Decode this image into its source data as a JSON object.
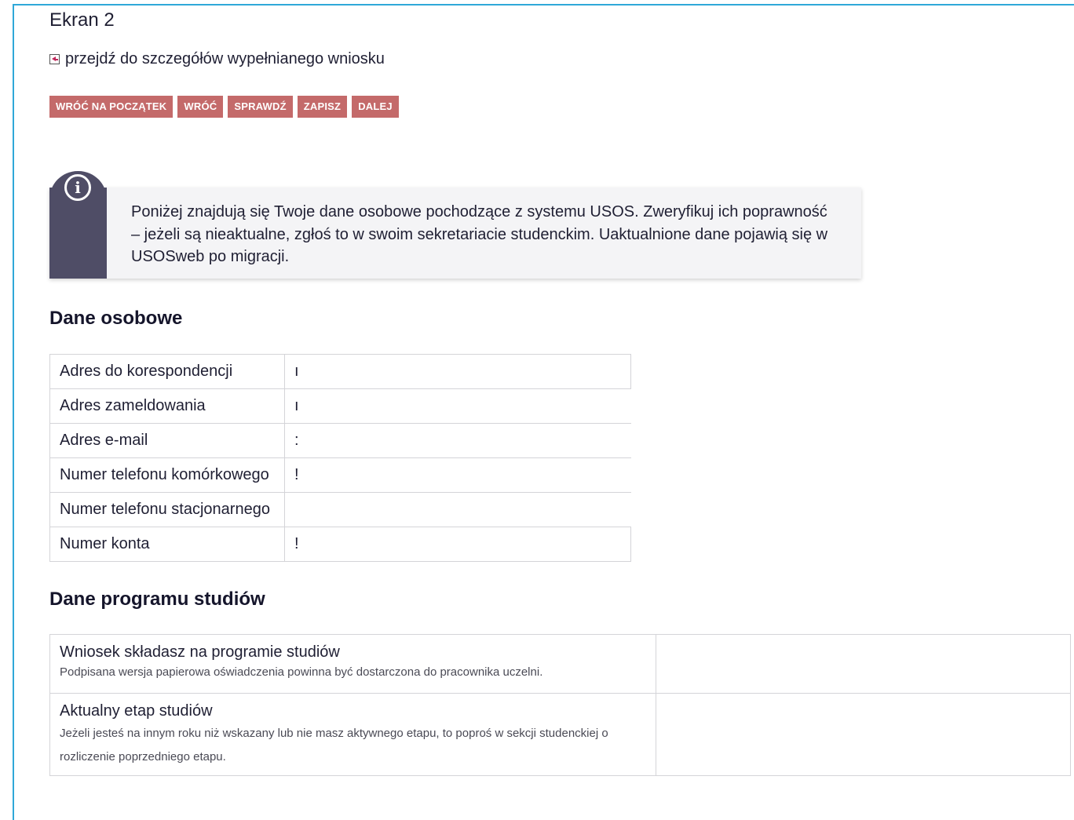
{
  "screen": {
    "title": "Ekran 2",
    "back_link": "przejdź do szczegółów wypełnianego wniosku"
  },
  "toolbar": {
    "buttons": [
      {
        "label": "WRÓĆ NA POCZĄTEK"
      },
      {
        "label": "WRÓĆ"
      },
      {
        "label": "SPRAWDŹ"
      },
      {
        "label": "ZAPISZ"
      },
      {
        "label": "DALEJ"
      }
    ]
  },
  "info": {
    "icon": "info-icon",
    "text": "Poniżej znajdują się Twoje dane osobowe pochodzące z systemu USOS. Zweryfikuj ich poprawność – jeżeli są nieaktualne, zgłoś to w swoim sekretariacie studenckim. Uaktualnione dane pojawią się w USOSweb po migracji."
  },
  "personal": {
    "title": "Dane osobowe",
    "rows": [
      {
        "label": "Adres do korespondencji",
        "value": "ı"
      },
      {
        "label": "Adres zameldowania",
        "value": "ı"
      },
      {
        "label": "Adres e-mail",
        "value": ":"
      },
      {
        "label": "Numer telefonu komórkowego",
        "value": "!"
      },
      {
        "label": "Numer telefonu stacjonarnego",
        "value": ""
      },
      {
        "label": "Numer konta",
        "value": "!"
      }
    ]
  },
  "program": {
    "title": "Dane programu studiów",
    "rows": [
      {
        "label": "Wniosek składasz na programie studiów",
        "note": "Podpisana wersja papierowa oświadczenia powinna być dostarczona do pracownika uczelni.",
        "value": ""
      },
      {
        "label": "Aktualny etap studiów",
        "note": "Jeżeli jesteś na innym roku niż wskazany lub nie masz aktywnego etapu, to poproś w sekcji studenckiej o rozliczenie poprzedniego etapu.",
        "value": ""
      }
    ]
  },
  "colors": {
    "frame_border": "#2fa8d8",
    "button_bg": "#c46a6a",
    "info_stripe": "#4f4d66",
    "info_bg": "#f4f4f6"
  }
}
